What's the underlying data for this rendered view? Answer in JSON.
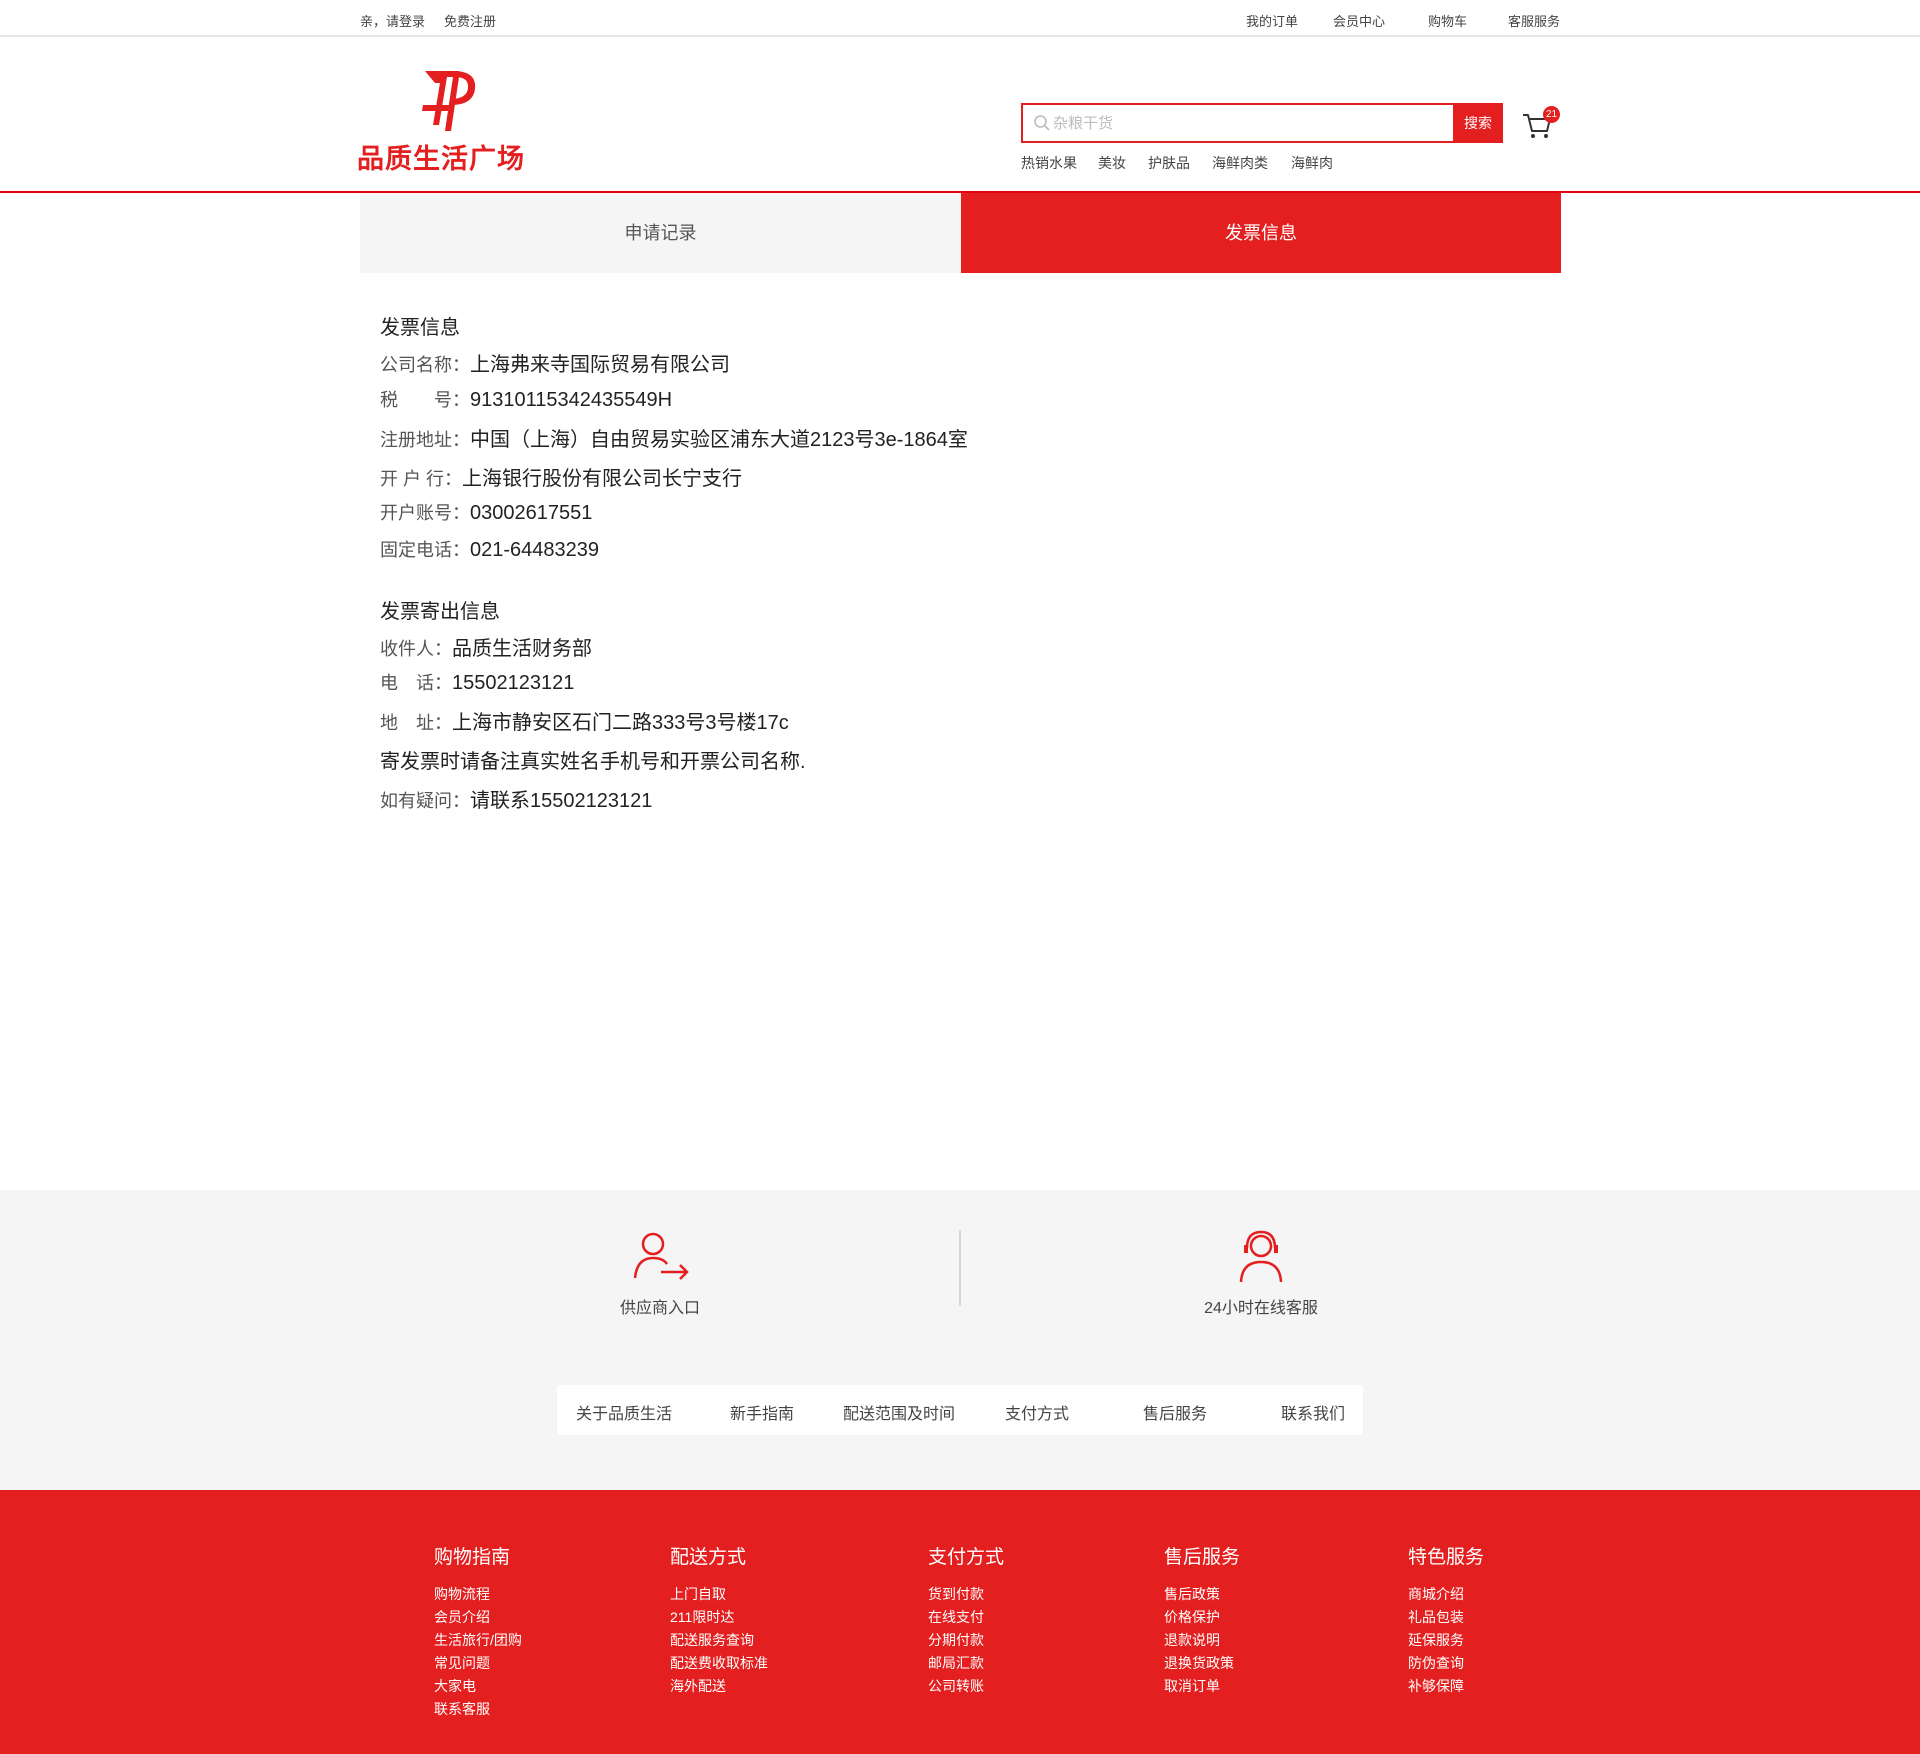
{
  "topbar": {
    "greeting": "亲，请登录",
    "register": "免费注册",
    "links": [
      "我的订单",
      "会员中心",
      "购物车",
      "客服服务"
    ]
  },
  "header": {
    "logo_text": "品质生活广场",
    "search_placeholder": "杂粮干货",
    "search_button": "搜索",
    "hot_keywords": [
      "热销水果",
      "美妆",
      "护肤品",
      "海鲜肉类",
      "海鲜肉"
    ],
    "cart_count": "21",
    "brand_color": "#e41f1f"
  },
  "tabs": [
    "申请记录",
    "发票信息"
  ],
  "invoice": {
    "title": "发票信息",
    "rows": [
      {
        "label": "公司名称：",
        "value": "上海弗来寺国际贸易有限公司"
      },
      {
        "label": "税　　号：",
        "value": "91310115342435549H"
      },
      {
        "label": "注册地址：",
        "value": "中国（上海）自由贸易实验区浦东大道2123号3e-1864室"
      },
      {
        "label": "开 户 行：",
        "value": "上海银行股份有限公司长宁支行"
      },
      {
        "label": "开户账号：",
        "value": "03002617551"
      },
      {
        "label": "固定电话：",
        "value": "021-64483239"
      }
    ]
  },
  "mailing": {
    "title": "发票寄出信息",
    "rows": [
      {
        "label": "收件人：",
        "value": "品质生活财务部"
      },
      {
        "label": "电　话：",
        "value": "15502123121"
      },
      {
        "label": "地　址：",
        "value": "上海市静安区石门二路333号3号楼17c"
      }
    ],
    "note": "寄发票时请备注真实姓名手机号和开票公司名称.",
    "contact_label": "如有疑问：",
    "contact_value": "请联系15502123121"
  },
  "services": {
    "supplier": "供应商入口",
    "support": "24小时在线客服",
    "links": [
      "关于品质生活",
      "新手指南",
      "配送范围及时间",
      "支付方式",
      "售后服务",
      "联系我们"
    ]
  },
  "footer_columns": [
    {
      "title": "购物指南",
      "items": [
        "购物流程",
        "会员介绍",
        "生活旅行/团购",
        "常见问题",
        "大家电",
        "联系客服"
      ]
    },
    {
      "title": "配送方式",
      "items": [
        "上门自取",
        "211限时达",
        "配送服务查询",
        "配送费收取标准",
        "海外配送"
      ]
    },
    {
      "title": "支付方式",
      "items": [
        "货到付款",
        "在线支付",
        "分期付款",
        "邮局汇款",
        "公司转账"
      ]
    },
    {
      "title": "售后服务",
      "items": [
        "售后政策",
        "价格保护",
        "退款说明",
        "退换货政策",
        "取消订单"
      ]
    },
    {
      "title": "特色服务",
      "items": [
        "商城介绍",
        "礼品包装",
        "延保服务",
        "防伪查询",
        "补够保障"
      ]
    }
  ]
}
